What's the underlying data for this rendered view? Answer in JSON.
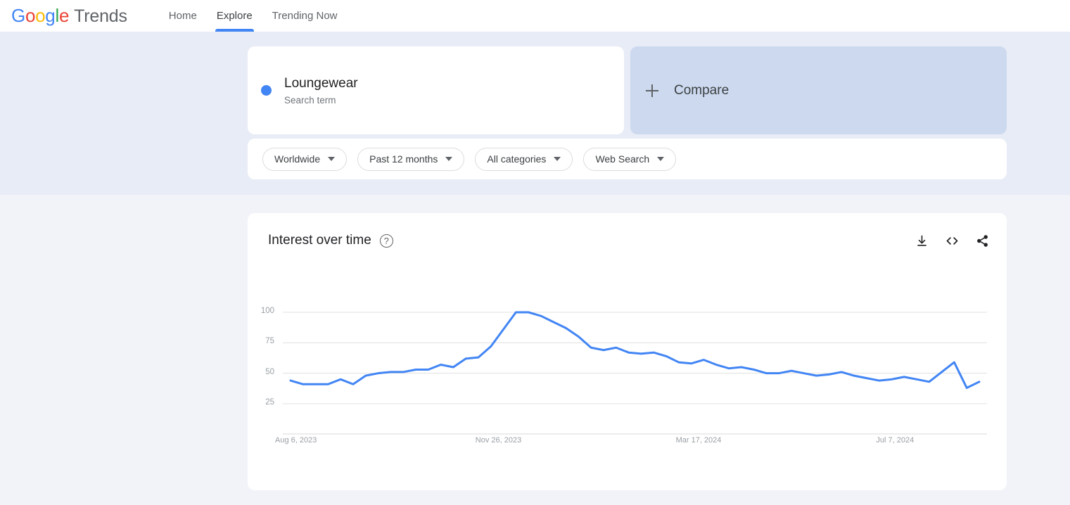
{
  "header": {
    "brand": {
      "google": [
        "G",
        "o",
        "o",
        "g",
        "l",
        "e"
      ],
      "suffix": "Trends"
    },
    "nav": [
      {
        "label": "Home",
        "active": false
      },
      {
        "label": "Explore",
        "active": true
      },
      {
        "label": "Trending Now",
        "active": false
      }
    ]
  },
  "query": {
    "term": {
      "title": "Loungewear",
      "subtitle": "Search term",
      "color": "#4285F4"
    },
    "compare": {
      "label": "Compare",
      "icon": "plus-icon"
    }
  },
  "filters": [
    {
      "label": "Worldwide"
    },
    {
      "label": "Past 12 months"
    },
    {
      "label": "All categories"
    },
    {
      "label": "Web Search"
    }
  ],
  "chart_panel": {
    "title": "Interest over time",
    "help_glyph": "?",
    "actions": [
      {
        "name": "download-icon"
      },
      {
        "name": "embed-code-icon"
      },
      {
        "name": "share-icon"
      }
    ]
  },
  "chart_data": {
    "type": "line",
    "title": "Interest over time",
    "xlabel": "",
    "ylabel": "",
    "ylim": [
      0,
      100
    ],
    "yticks": [
      100,
      75,
      50,
      25
    ],
    "grid": true,
    "legend": false,
    "line_color": "#4285F4",
    "xticks": [
      "Aug 6, 2023",
      "Nov 26, 2023",
      "Mar 17, 2024",
      "Jul 7, 2024"
    ],
    "xtick_indices": [
      0,
      16,
      32,
      48
    ],
    "series": [
      {
        "name": "Loungewear",
        "values": [
          44,
          41,
          41,
          41,
          45,
          41,
          48,
          50,
          51,
          51,
          53,
          53,
          57,
          55,
          62,
          63,
          72,
          86,
          100,
          100,
          97,
          92,
          87,
          80,
          71,
          69,
          71,
          67,
          66,
          67,
          64,
          59,
          58,
          61,
          57,
          54,
          55,
          53,
          50,
          50,
          52,
          50,
          48,
          49,
          51,
          48,
          46,
          44,
          45,
          47,
          45,
          43,
          51,
          59,
          38,
          43
        ]
      }
    ]
  }
}
